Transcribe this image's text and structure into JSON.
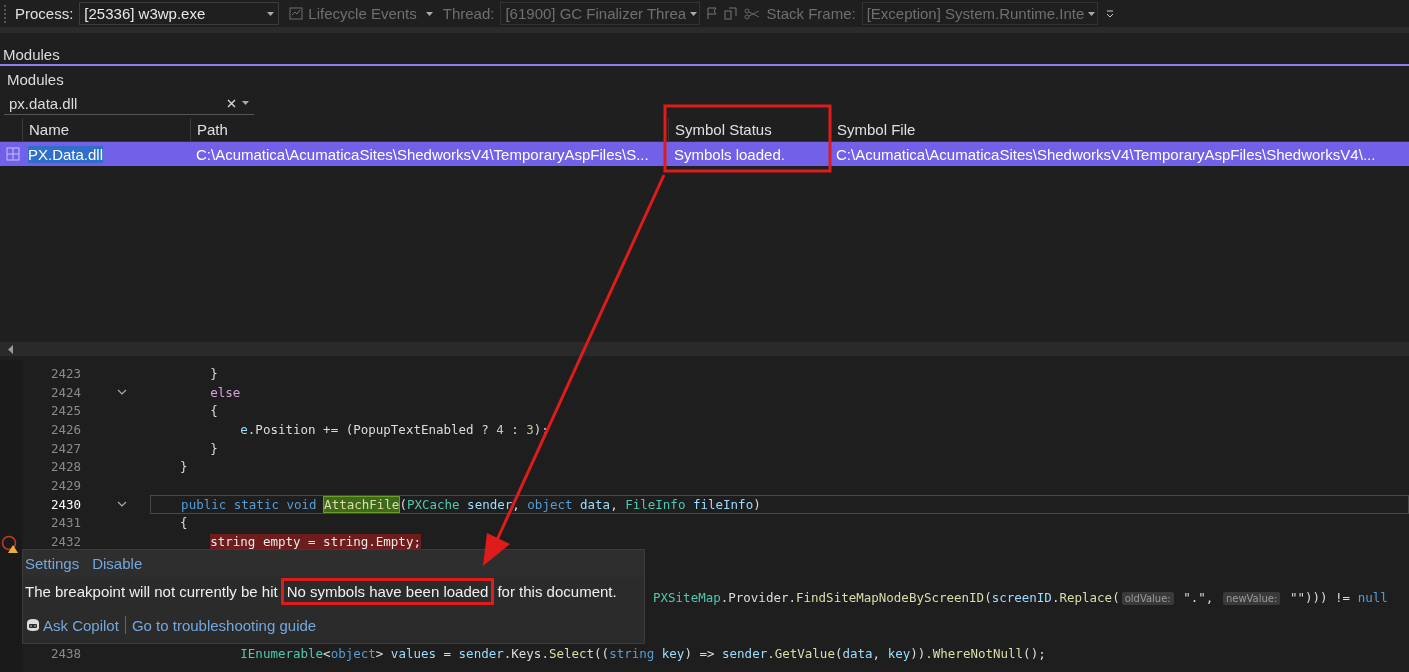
{
  "toolbar": {
    "process": {
      "label": "Process:",
      "value": "[25336] w3wp.exe",
      "disabled": false
    },
    "lifecycle_events": {
      "label": "Lifecycle Events",
      "disabled": true
    },
    "thread": {
      "label": "Thread:",
      "value": "[61900] GC Finalizer Threa",
      "disabled": true
    },
    "stack_frame": {
      "label": "Stack Frame:",
      "value": "[Exception] System.Runtime.Inte",
      "disabled": true
    }
  },
  "tool_window_tab": {
    "label": "Modules"
  },
  "modules": {
    "title": "Modules",
    "filter": {
      "value": "px.data.dll"
    },
    "columns": [
      "Name",
      "Path",
      "Symbol Status",
      "Symbol File"
    ],
    "rows": [
      {
        "name": "PX.Data.dll",
        "path": "C:\\Acumatica\\AcumaticaSites\\ShedworksV4\\TemporaryAspFiles\\S...",
        "symbol_status": "Symbols loaded.",
        "symbol_file": "C:\\Acumatica\\AcumaticaSites\\ShedworksV4\\TemporaryAspFiles\\ShedworksV4\\...",
        "selected": true
      }
    ]
  },
  "editor": {
    "lines": [
      {
        "number": "2423",
        "current": false,
        "fold": false,
        "breakpoint": false,
        "tokens": [
          {
            "text": "        }",
            "kind": "plain"
          }
        ]
      },
      {
        "number": "2424",
        "current": false,
        "fold": true,
        "breakpoint": false,
        "tokens": [
          {
            "text": "        else",
            "kind": "control"
          }
        ]
      },
      {
        "number": "2425",
        "current": false,
        "fold": false,
        "breakpoint": false,
        "tokens": [
          {
            "text": "        {",
            "kind": "plain"
          }
        ]
      },
      {
        "number": "2426",
        "current": false,
        "fold": false,
        "breakpoint": false,
        "tokens": [
          {
            "text": "            e",
            "kind": "variable"
          },
          {
            "text": ".Position += (PopupTextEnabled ? ",
            "kind": "plain"
          },
          {
            "text": "4",
            "kind": "number"
          },
          {
            "text": " : ",
            "kind": "plain"
          },
          {
            "text": "3",
            "kind": "number"
          },
          {
            "text": ");",
            "kind": "plain"
          }
        ]
      },
      {
        "number": "2427",
        "current": false,
        "fold": false,
        "breakpoint": false,
        "tokens": [
          {
            "text": "        }",
            "kind": "plain"
          }
        ]
      },
      {
        "number": "2428",
        "current": false,
        "fold": false,
        "breakpoint": false,
        "tokens": [
          {
            "text": "    }",
            "kind": "plain"
          }
        ]
      },
      {
        "number": "2429",
        "current": false,
        "fold": false,
        "breakpoint": false
      },
      {
        "number": "2430",
        "current": true,
        "fold": true,
        "breakpoint": false,
        "tokens": [
          {
            "text": "    public static void ",
            "kind": "keyword"
          },
          {
            "text": "AttachFile",
            "kind": "match"
          },
          {
            "text": "(",
            "kind": "plain"
          },
          {
            "text": "PXCache",
            "kind": "type"
          },
          {
            "text": " sender",
            "kind": "variable"
          },
          {
            "text": ", ",
            "kind": "plain"
          },
          {
            "text": "object",
            "kind": "keyword"
          },
          {
            "text": " data",
            "kind": "variable"
          },
          {
            "text": ", ",
            "kind": "plain"
          },
          {
            "text": "FileInfo",
            "kind": "type"
          },
          {
            "text": " fileInfo",
            "kind": "variable"
          },
          {
            "text": ")",
            "kind": "plain"
          }
        ]
      },
      {
        "number": "2431",
        "current": false,
        "fold": false,
        "breakpoint": false,
        "tokens": [
          {
            "text": "    {",
            "kind": "plain"
          }
        ]
      },
      {
        "number": "2432",
        "current": false,
        "fold": false,
        "breakpoint": true,
        "tokens": [
          {
            "text": "        string empty = string.Empty;",
            "kind": "plain"
          }
        ]
      }
    ],
    "partial_line": {
      "tokens": [
        {
          "text": "PXSiteMap",
          "kind": "type"
        },
        {
          "text": ".Provider.",
          "kind": "plain"
        },
        {
          "text": "FindSiteMapNodeByScreenID",
          "kind": "method"
        },
        {
          "text": "(",
          "kind": "plain"
        },
        {
          "text": "screenID",
          "kind": "variable"
        },
        {
          "text": ".",
          "kind": "plain"
        },
        {
          "text": "Replace",
          "kind": "method"
        },
        {
          "text": "(",
          "kind": "plain"
        },
        {
          "text": "oldValue:",
          "kind": "hint"
        },
        {
          "text": " \".\", ",
          "kind": "plain"
        },
        {
          "text": "newValue:",
          "kind": "hint"
        },
        {
          "text": " \"\"))) != ",
          "kind": "plain"
        },
        {
          "text": "null",
          "kind": "keyword"
        }
      ]
    },
    "lines_after": [
      {
        "number": "2438",
        "current": false,
        "fold": false,
        "breakpoint": false,
        "tokens": [
          {
            "text": "            IEnumerable",
            "kind": "type"
          },
          {
            "text": "<",
            "kind": "plain"
          },
          {
            "text": "object",
            "kind": "keyword"
          },
          {
            "text": "> ",
            "kind": "plain"
          },
          {
            "text": "values",
            "kind": "variable"
          },
          {
            "text": " = ",
            "kind": "plain"
          },
          {
            "text": "sender",
            "kind": "variable"
          },
          {
            "text": ".Keys.",
            "kind": "plain"
          },
          {
            "text": "Select",
            "kind": "method"
          },
          {
            "text": "((",
            "kind": "plain"
          },
          {
            "text": "string",
            "kind": "keyword"
          },
          {
            "text": " key",
            "kind": "variable"
          },
          {
            "text": ") => ",
            "kind": "plain"
          },
          {
            "text": "sender",
            "kind": "variable"
          },
          {
            "text": ".",
            "kind": "plain"
          },
          {
            "text": "GetValue",
            "kind": "method"
          },
          {
            "text": "(",
            "kind": "plain"
          },
          {
            "text": "data",
            "kind": "variable"
          },
          {
            "text": ", ",
            "kind": "plain"
          },
          {
            "text": "key",
            "kind": "variable"
          },
          {
            "text": ")).",
            "kind": "plain"
          },
          {
            "text": "WhereNotNull",
            "kind": "method"
          },
          {
            "text": "();",
            "kind": "plain"
          }
        ]
      }
    ]
  },
  "popup": {
    "links": [
      "Settings",
      "Disable"
    ],
    "message": {
      "before": "The breakpoint will not currently be hit",
      "highlighted": "No symbols have been loaded",
      "after": "for this document."
    },
    "actions": [
      {
        "label": "Ask Copilot",
        "kind": "copilot"
      },
      {
        "label": "Go to troubleshooting guide",
        "kind": "link"
      }
    ]
  }
}
